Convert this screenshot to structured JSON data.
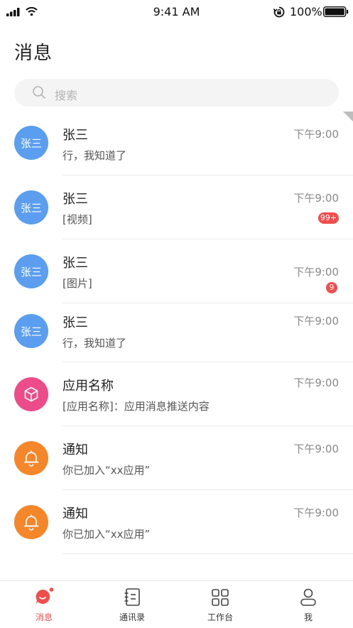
{
  "status_bar": {
    "time": "9:41 AM",
    "battery": "100%"
  },
  "header": {
    "title": "消息"
  },
  "search": {
    "placeholder": "搜索"
  },
  "conversations": [
    {
      "name": "张三",
      "avatar_text": "张三",
      "avatar_kind": "user",
      "message": "行，我知道了",
      "time": "下午9:00",
      "badge": ""
    },
    {
      "name": "张三",
      "avatar_text": "张三",
      "avatar_kind": "user",
      "message": "[视频]",
      "time": "下午9:00",
      "badge": "99+"
    },
    {
      "name": "张三",
      "avatar_text": "张三",
      "avatar_kind": "user",
      "message": "[图片]",
      "time": "下午9:00",
      "badge": "9"
    },
    {
      "name": "张三",
      "avatar_text": "张三",
      "avatar_kind": "user",
      "message": "行，我知道了",
      "time": "下午9:00",
      "badge": ""
    },
    {
      "name": "应用名称",
      "avatar_text": "",
      "avatar_kind": "cube-icon",
      "message": "[应用名称]：应用消息推送内容",
      "time": "下午9:00",
      "badge": ""
    },
    {
      "name": "通知",
      "avatar_text": "",
      "avatar_kind": "bell-icon",
      "message": "你已加入“xx应用”",
      "time": "下午9:00",
      "badge": ""
    },
    {
      "name": "通知",
      "avatar_text": "",
      "avatar_kind": "bell-icon",
      "message": "你已加入“xx应用”",
      "time": "下午9:00",
      "badge": ""
    }
  ],
  "tabbar": {
    "items": [
      {
        "label": "消息",
        "icon": "chat-icon",
        "active": true
      },
      {
        "label": "通讯录",
        "icon": "contacts-icon",
        "active": false
      },
      {
        "label": "工作台",
        "icon": "grid-icon",
        "active": false
      },
      {
        "label": "我",
        "icon": "person-icon",
        "active": false
      }
    ]
  },
  "colors": {
    "accent": "#f24d4d",
    "user_avatar": "#5b9ef0",
    "app_avatar": "#ec4d8a",
    "notice_avatar": "#f5862a"
  }
}
